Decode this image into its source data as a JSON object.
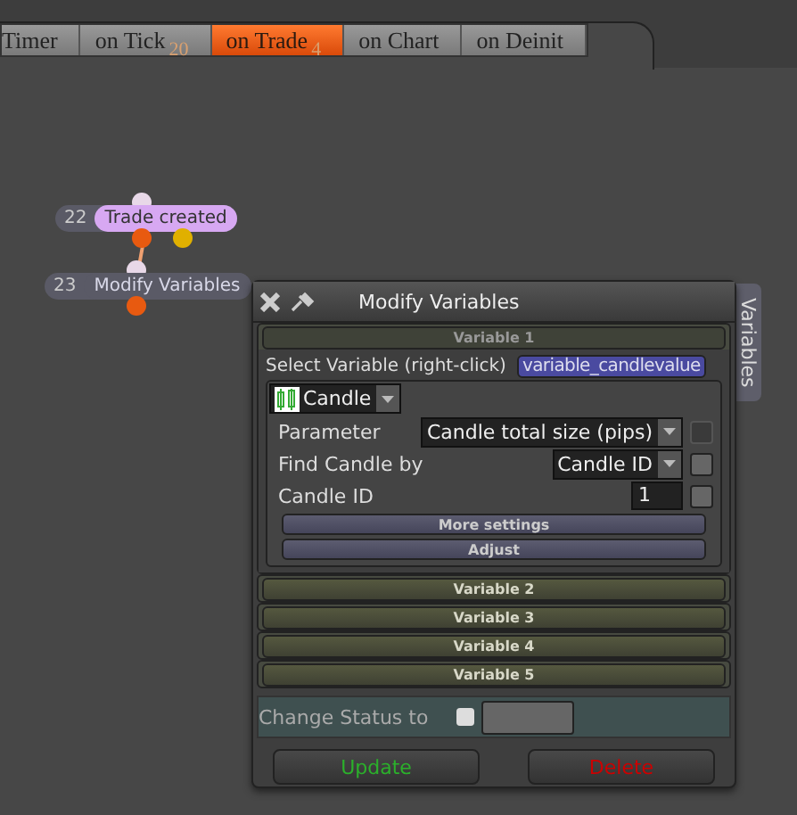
{
  "tabs": [
    {
      "label": "Timer",
      "selected": false
    },
    {
      "label": "on Tick",
      "badge": "20",
      "selected": false
    },
    {
      "label": "on Trade",
      "badge": "4",
      "selected": true
    },
    {
      "label": "on Chart",
      "selected": false
    },
    {
      "label": "on Deinit",
      "selected": false
    }
  ],
  "nodes": [
    {
      "number": "22",
      "label": "Trade created",
      "kind": "event"
    },
    {
      "number": "23",
      "label": "Modify Variables",
      "kind": "action"
    }
  ],
  "panel": {
    "title": "Modify Variables",
    "side_tab": "Variables",
    "sections": [
      {
        "title": "Variable 1",
        "expanded": true
      },
      {
        "title": "Variable 2",
        "expanded": false
      },
      {
        "title": "Variable 3",
        "expanded": false
      },
      {
        "title": "Variable 4",
        "expanded": false
      },
      {
        "title": "Variable 5",
        "expanded": false
      }
    ],
    "select_label": "Select Variable (right-click)",
    "select_value": "variable_candlevalue",
    "type_dropdown": "Candle",
    "rows": [
      {
        "label": "Parameter",
        "kind": "dropdown",
        "value": "Candle total size (pips)",
        "checked": false,
        "disabled": true
      },
      {
        "label": "Find Candle by",
        "kind": "dropdown",
        "value": "Candle ID",
        "checked": false,
        "disabled": false
      },
      {
        "label": "Candle ID",
        "kind": "input",
        "value": "1",
        "checked": false,
        "disabled": false
      }
    ],
    "sub_buttons": [
      "More settings",
      "Adjust"
    ],
    "status": {
      "label": "Change Status to",
      "checked": false
    },
    "buttons": [
      {
        "label": "Update",
        "kind": "update"
      },
      {
        "label": "Delete",
        "kind": "delete"
      }
    ]
  }
}
